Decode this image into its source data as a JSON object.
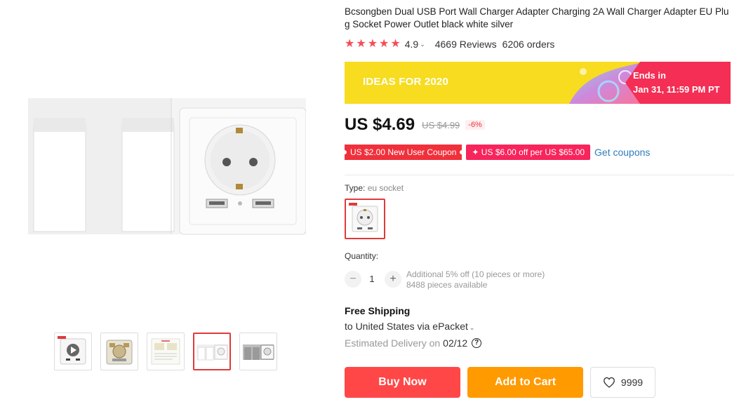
{
  "product": {
    "title": "Bcsongben Dual USB Port Wall Charger Adapter Charging 2A Wall Charger Adapter EU Plug Socket Power Outlet black white silver",
    "rating": "4.9",
    "reviews": "4669 Reviews",
    "orders": "6206 orders"
  },
  "banner": {
    "label": "IDEAS FOR 2020",
    "ends_label": "Ends in",
    "ends_date": "Jan 31, 11:59 PM PT",
    "colors": {
      "yellow": "#f7dc1f",
      "red": "#f42e54"
    }
  },
  "price": {
    "current": "US $4.69",
    "original": "US $4.99",
    "discount": "-6%"
  },
  "coupons": {
    "new_user": "US $2.00 New User Coupon",
    "store": "✦ US $6.00 off per US $65.00",
    "get_link": "Get coupons"
  },
  "sku": {
    "label": "Type: ",
    "value": "eu socket"
  },
  "quantity": {
    "label": "Quantity:",
    "value": "1",
    "minus": "−",
    "plus": "+",
    "note": "Additional 5% off (10 pieces or more)",
    "available": "8488 pieces available"
  },
  "shipping": {
    "title": "Free Shipping",
    "destination": "to United States via ePacket",
    "delivery_label": "Estimated Delivery on",
    "delivery_date": "02/12",
    "help": "?"
  },
  "actions": {
    "buy_now": "Buy Now",
    "add_to_cart": "Add to Cart",
    "wishlist_count": "9999"
  },
  "gallery": {
    "thumbnails": [
      "video-thumbnail",
      "socket-back",
      "instruction-sheet",
      "white-socket-holder",
      "silver-socket-holder"
    ],
    "active_index": 3
  },
  "theme": {
    "accent_red": "#ff4747",
    "accent_orange": "#ff9a00",
    "star_color": "#f54d59",
    "link_blue": "#2e7dbd"
  }
}
